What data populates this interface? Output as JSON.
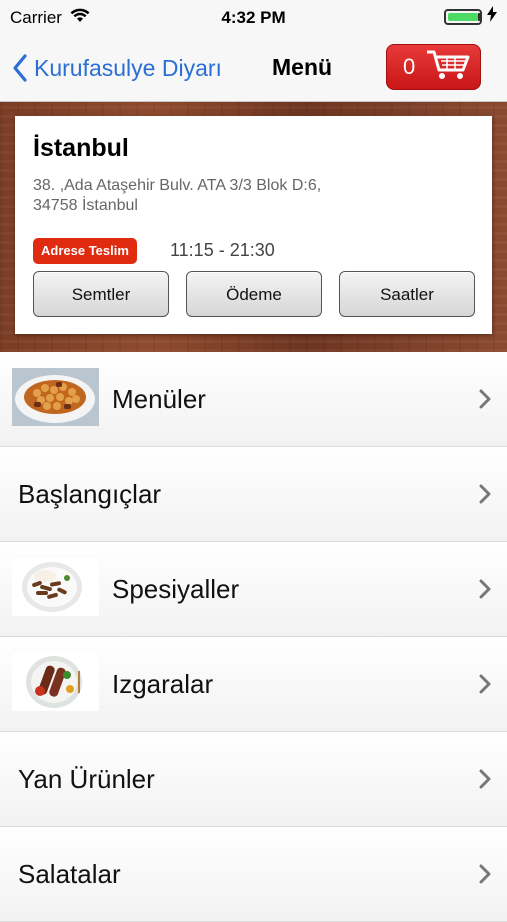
{
  "status_bar": {
    "carrier": "Carrier",
    "time": "4:32 PM"
  },
  "nav": {
    "back_label": "Kurufasulye Diyarı",
    "title": "Menü",
    "cart_count": "0"
  },
  "restaurant": {
    "city": "İstanbul",
    "address_line1": "38. ,Ada Ataşehir Bulv. ATA 3/3 Blok D:6,",
    "address_line2": "34758 İstanbul",
    "delivery_badge": "Adrese Teslim",
    "hours": "11:15 - 21:30",
    "buttons": {
      "districts": "Semtler",
      "payment": "Ödeme",
      "hours": "Saatler"
    }
  },
  "menu": [
    {
      "label": "Menüler",
      "icon": "chickpea-dish-icon"
    },
    {
      "label": "Başlangıçlar",
      "icon": null
    },
    {
      "label": "Spesiyaller",
      "icon": "special-plate-icon"
    },
    {
      "label": "Izgaralar",
      "icon": "grill-plate-icon"
    },
    {
      "label": "Yan Ürünler",
      "icon": null
    },
    {
      "label": "Salatalar",
      "icon": null
    }
  ],
  "colors": {
    "accent_blue": "#2a6fd4",
    "cart_red": "#d42323",
    "badge_red": "#e02b10"
  }
}
